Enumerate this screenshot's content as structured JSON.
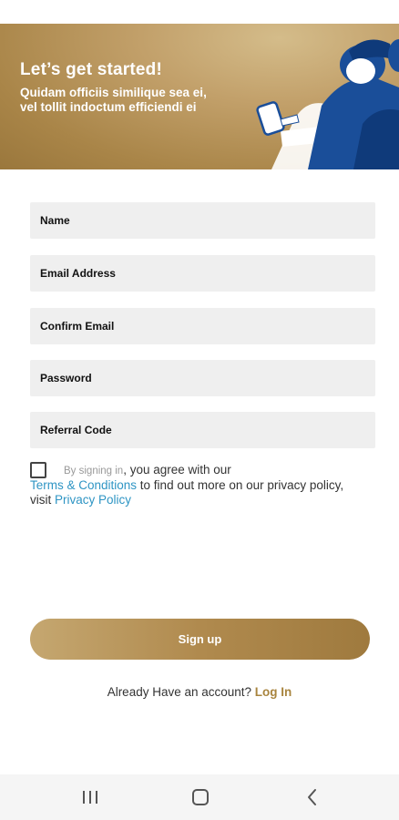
{
  "hero": {
    "title": "Let’s get started!",
    "subtitle": "Quidam officiis similique sea ei, vel tollit indoctum efficiendi ei"
  },
  "form": {
    "fields": [
      {
        "label": "Name"
      },
      {
        "label": "Email Address"
      },
      {
        "label": "Confirm Email"
      },
      {
        "label": "Password"
      },
      {
        "label": "Referral Code"
      }
    ],
    "consent": {
      "checked": false,
      "lead": "By signing in",
      "text_1": ", you agree with our",
      "terms_link": "Terms & Conditions",
      "text_2": " to find out more on our privacy policy, visit ",
      "privacy_link": "Privacy Policy"
    },
    "submit_label": "Sign up"
  },
  "login": {
    "prompt": "Already Have an account? ",
    "link": "Log In"
  },
  "colors": {
    "accent_gold": "#a8843e",
    "link_blue": "#2f95c4",
    "field_bg": "#efefef"
  },
  "nav": {
    "icons": [
      "recent-apps-icon",
      "home-icon",
      "back-icon"
    ]
  }
}
